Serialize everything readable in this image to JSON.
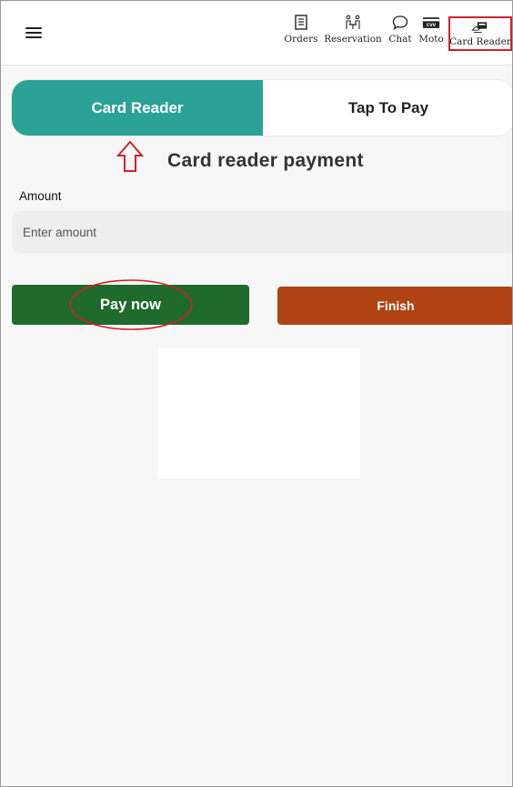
{
  "topbar": {
    "menu_icon": "hamburger-menu-icon",
    "nav": [
      {
        "label": "Orders",
        "icon": "orders-list-icon"
      },
      {
        "label": "Reservation",
        "icon": "reservation-table-icon"
      },
      {
        "label": "Chat",
        "icon": "chat-bubble-icon"
      },
      {
        "label": "Moto",
        "icon": "cvv-card-icon"
      },
      {
        "label": "Card Reader",
        "icon": "card-reader-icon"
      }
    ],
    "cvv_text": "CVV"
  },
  "tabs": {
    "card_reader": "Card Reader",
    "tap_to_pay": "Tap To Pay"
  },
  "page_title": "Card reader payment",
  "amount": {
    "label": "Amount",
    "placeholder": "Enter amount",
    "value": ""
  },
  "buttons": {
    "pay_now": "Pay now",
    "finish": "Finish"
  },
  "colors": {
    "accent_teal": "#2aa396",
    "pay_green": "#1e6b2b",
    "finish_orange": "#b04313",
    "annotation_red": "#d3202a"
  }
}
